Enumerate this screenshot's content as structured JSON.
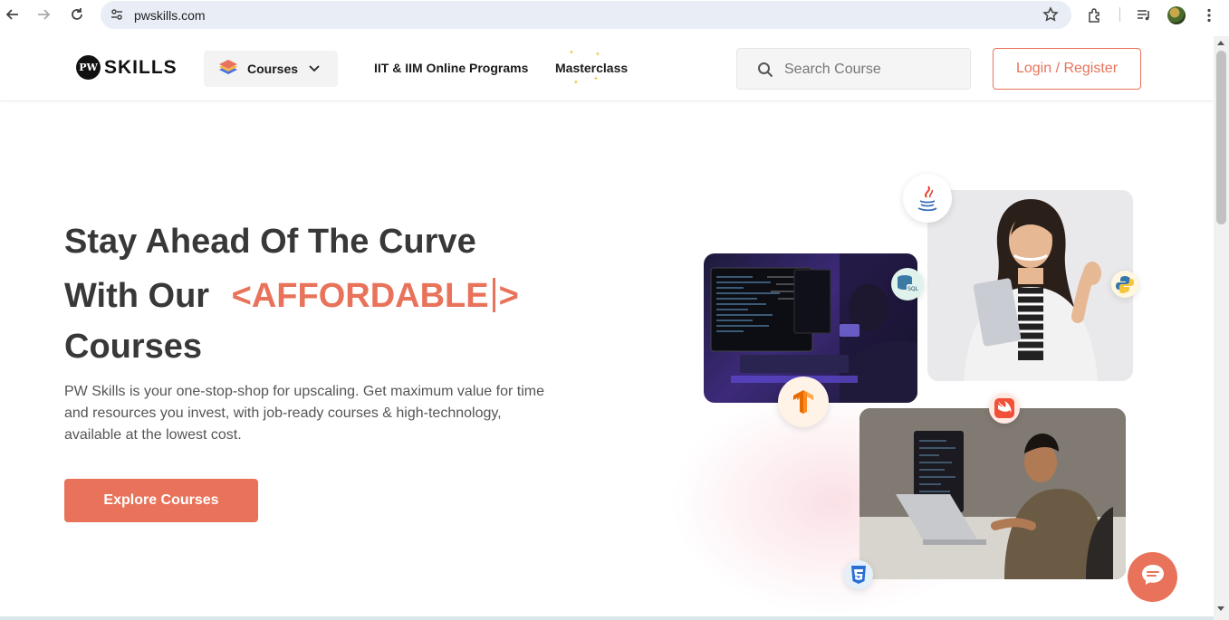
{
  "browser": {
    "url": "pwskills.com",
    "icons": [
      "back-icon",
      "forward-icon",
      "reload-icon",
      "site-info-icon",
      "bookmark-star-icon",
      "extensions-icon",
      "media-icon",
      "profile-avatar",
      "menu-icon"
    ]
  },
  "header": {
    "logo_mark": "PW",
    "logo_text": "SKILLS",
    "courses_label": "Courses",
    "nav_links": [
      "IIT & IIM Online Programs",
      "Masterclass"
    ],
    "search_placeholder": "Search Course",
    "login_label": "Login / Register"
  },
  "hero": {
    "line1": "Stay Ahead Of The Curve",
    "line2_prefix": "With Our",
    "highlight_open": "<AFFORDABLE",
    "highlight_close": ">",
    "line3": "Courses",
    "description": "PW Skills is your one-stop-shop for upscaling. Get maximum value for time and resources you invest, with job-ready courses & high-technology, available at the lowest cost.",
    "cta_label": "Explore Courses"
  },
  "collage": {
    "badges": [
      "java-icon",
      "sql-icon",
      "python-icon",
      "tensorflow-icon",
      "swift-icon",
      "css3-icon"
    ],
    "sql_text": "SQL"
  },
  "colors": {
    "accent": "#e8735a",
    "heading": "#383838",
    "body_text": "#555555"
  }
}
